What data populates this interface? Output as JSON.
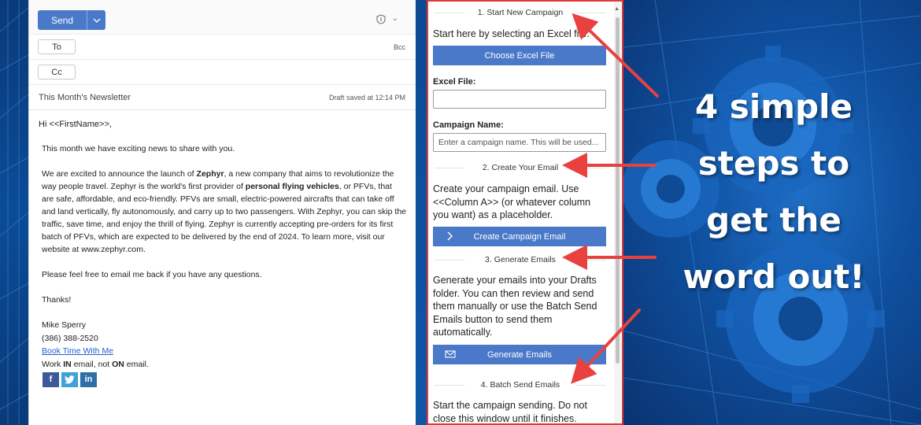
{
  "email": {
    "send_label": "Send",
    "to_label": "To",
    "cc_label": "Cc",
    "bcc_label": "Bcc",
    "subject": "This Month's Newsletter",
    "draft_saved": "Draft saved at 12:14 PM",
    "greeting": "Hi <<FirstName>>,",
    "para1": "This month we have exciting news to share with you.",
    "para2_a": "We are excited to announce the launch of ",
    "para2_brand": "Zephyr",
    "para2_b": ", a new company that aims to revolutionize the way people travel. Zephyr is the world's first provider of ",
    "para2_bold": "personal flying vehicles",
    "para2_c": ", or PFVs, that are safe, affordable, and eco-friendly. PFVs are small, electric-powered aircrafts that can take off and land vertically, fly autonomously, and carry up to two passengers. With Zephyr, you can skip the traffic, save time, and enjoy the thrill of flying. Zephyr is currently accepting pre-orders for its first batch of PFVs, which are expected to be delivered by the end of 2024. To learn more, visit our website at www.zephyr.com.",
    "para3": "Please feel free to email me back if you have any questions.",
    "para4": "Thanks!",
    "sig_name": "Mike Sperry",
    "sig_phone": "(386) 388-2520",
    "sig_link": "Book Time With Me",
    "sig_work_a": "Work ",
    "sig_work_in": "IN",
    "sig_work_b": " email, not ",
    "sig_work_on": "ON",
    "sig_work_c": " email.",
    "social": {
      "facebook": "f",
      "twitter": "t",
      "linkedin": "in"
    }
  },
  "panel": {
    "step1_title": "1. Start New Campaign",
    "step1_text": "Start here by selecting an Excel file.",
    "choose_file_label": "Choose Excel File",
    "excel_file_label": "Excel File:",
    "excel_file_value": "",
    "campaign_name_label": "Campaign Name:",
    "campaign_name_placeholder": "Enter a campaign name.  This will be used...",
    "step2_title": "2. Create Your Email",
    "step2_text": "Create your campaign email. Use <<Column A>> (or whatever column you want) as a placeholder.",
    "create_email_label": "Create Campaign Email",
    "step3_title": "3. Generate Emails",
    "step3_text": "Generate your emails into your Drafts folder. You can then review and send them manually or use the Batch Send Emails button to send them automatically.",
    "generate_label": "Generate Emails",
    "step4_title": "4. Batch Send Emails",
    "step4_text": "Start the campaign sending. Do not close this window until it finishes."
  },
  "headline": [
    "4 simple",
    "steps to",
    "get the",
    "word out!"
  ],
  "colors": {
    "accent": "#4a79c9",
    "border": "#e03a3a",
    "arrow": "#e8413f"
  }
}
